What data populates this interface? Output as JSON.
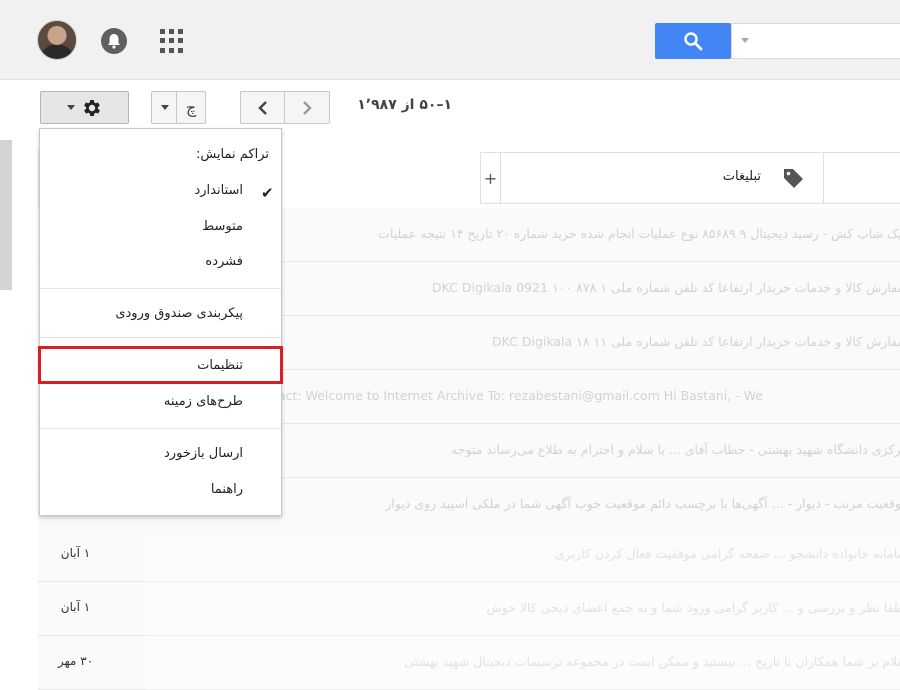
{
  "toolbar": {
    "refresh_label": "چ",
    "pager_text": "۱–۵۰ از ۱٬۹۸۷"
  },
  "tabs": {
    "add_label": "+",
    "promotions_label": "تبلیغات"
  },
  "settings_menu": {
    "density_heading": "تراکم نمایش:",
    "density_options": [
      "استاندارد",
      "متوسط",
      "فشرده"
    ],
    "selected_density": "استاندارد",
    "inbox_config": "پیکربندی صندوق ورودی",
    "settings": "تنظیمات",
    "themes": "طرح‌های زمینه",
    "send_feedback": "ارسال بازخورد",
    "help": "راهنما"
  },
  "messages": [
    {
      "date": "",
      "snippet": "فیک شاپ کش - رسید دیجیتال ۹ ۸۵۶۸۹ نوع عملیات انجام شده خرید شماره ۲۰ تاریخ ۱۴ نتیجه عملیات"
    },
    {
      "date": "",
      "snippet": "سفارش کالا و خدمات خریدار ارتفاعا کد تلفن شماره ملی ۱ ۸۷۸ ۱۰۰ 0921 DKC Digikala"
    },
    {
      "date": "",
      "snippet": "سفارش کالا و خدمات خریدار ارتفاعا کد تلفن شماره ملی ۱۱ ۱۸ DKC Digikala"
    },
    {
      "date": "",
      "snippet": "act: Welcome to Internet Archive To: rezabestani@gmail.com Hi Bastani, - We"
    },
    {
      "date": "",
      "snippet": "مرکزی دانشگاه شهید بهشتی - خطاب آقای ... با سلام و احترام به طلاع می‌رساند متوجه"
    },
    {
      "date": "",
      "snippet": "موقعیت مرتب - دیوار - ... آگهی‌ها با برچسب دائم موقعیت خوب آگهی شما در ملکی اسپید روی دیوار"
    },
    {
      "date": "۱ آبان",
      "snippet": "سامانه خانواده دانشجو ... صفحه گرامی موفقیت فعال کردن کاربری"
    },
    {
      "date": "۱ آبان",
      "snippet": "لطفا نظر و بررسی و ... کاربر گرامی ورود شما و به جمع اعضای دیجی کالا خوش"
    },
    {
      "date": "۳۰ مهر",
      "snippet": "سلام بر شما همکاران تا تاریخ ... نیستید و ممکن است در مجموعه ترسیمات دیجیتال شهید بهشتی"
    }
  ]
}
